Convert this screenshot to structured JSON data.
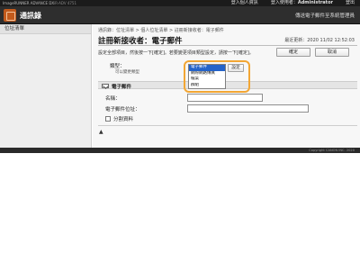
{
  "topbar": {
    "device_name": "ImageRUNNER ADVANCE DX",
    "model": "iR-ADV 4751",
    "login_link": "登入個人資訊",
    "login_user_prefix": "登入使用者：",
    "login_user": "Administrator",
    "logout_label": "登出"
  },
  "header": {
    "title": "通訊錄",
    "settings_link": "傳送電子郵件至系統管理員"
  },
  "sidebar": {
    "items": [
      {
        "label": "位址清單"
      }
    ]
  },
  "main": {
    "breadcrumb": "通訊錄：位址清單 > 個人位址清單 > 註冊新接收者：電子郵件",
    "title": "註冊新接收者：電子郵件",
    "last_updated": "最近更新：2020 11/02 12:52:03",
    "instructions": "設定全部項目，然後按一下[確定]。若要變更項目類型設定，請按一下[確定]。",
    "ok_button": "確定",
    "cancel_button": "取消"
  },
  "type_field": {
    "label": "類型：",
    "note": "可以變更類型",
    "options": [
      "電子郵件",
      "網際網路傳真",
      "檔案",
      "群組"
    ],
    "selected_index": 0,
    "set_button": "設定"
  },
  "email_section": {
    "title": "電子郵件",
    "name_label": "名稱：",
    "name_value": "",
    "email_label": "電子郵件位址：",
    "email_value": "",
    "split_label": "分割資料",
    "split_checked": false
  },
  "to_top_label": "▲",
  "footer": {
    "copyright": "Copyright CANON INC. 2020"
  },
  "colors": {
    "accent_ring": "#f2a634",
    "selection": "#2463c9",
    "header_bg": "#2e2e2e"
  }
}
